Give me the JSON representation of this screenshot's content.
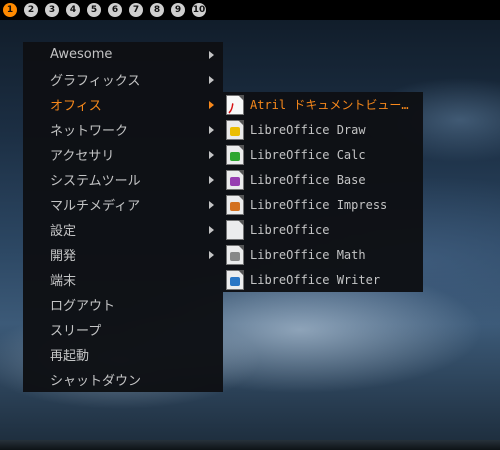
{
  "taskbar": {
    "tags": [
      "1",
      "2",
      "3",
      "4",
      "5",
      "6",
      "7",
      "8",
      "9",
      "10"
    ],
    "active_tag": "1"
  },
  "main_menu": {
    "items": [
      {
        "label": "Awesome",
        "submenu": true
      },
      {
        "label": "グラフィックス",
        "submenu": true
      },
      {
        "label": "オフィス",
        "submenu": true,
        "active": true
      },
      {
        "label": "ネットワーク",
        "submenu": true
      },
      {
        "label": "アクセサリ",
        "submenu": true
      },
      {
        "label": "システムツール",
        "submenu": true
      },
      {
        "label": "マルチメディア",
        "submenu": true
      },
      {
        "label": "設定",
        "submenu": true
      },
      {
        "label": "開発",
        "submenu": true
      },
      {
        "label": "端末"
      },
      {
        "label": "ログアウト"
      },
      {
        "label": "スリープ"
      },
      {
        "label": "再起動"
      },
      {
        "label": "シャットダウン"
      }
    ]
  },
  "office_submenu": {
    "items": [
      {
        "label": "Atril ドキュメントビュー…",
        "icon": "pdf-document-icon",
        "active": true
      },
      {
        "label": "LibreOffice Draw",
        "icon": "libreoffice-draw-icon",
        "color": "#f2c200"
      },
      {
        "label": "LibreOffice Calc",
        "icon": "libreoffice-calc-icon",
        "color": "#2eaa2e"
      },
      {
        "label": "LibreOffice Base",
        "icon": "libreoffice-base-icon",
        "color": "#9b3fb5"
      },
      {
        "label": "LibreOffice Impress",
        "icon": "libreoffice-impress-icon",
        "color": "#d9731f"
      },
      {
        "label": "LibreOffice",
        "icon": "libreoffice-icon",
        "color": "#e8e8e8"
      },
      {
        "label": "LibreOffice Math",
        "icon": "libreoffice-math-icon",
        "color": "#8a8a8a"
      },
      {
        "label": "LibreOffice Writer",
        "icon": "libreoffice-writer-icon",
        "color": "#2a78c8"
      }
    ]
  },
  "colors": {
    "accent": "#ff8c1a",
    "menu_bg": "#0e1014",
    "menu_text": "#c9c9c9"
  }
}
